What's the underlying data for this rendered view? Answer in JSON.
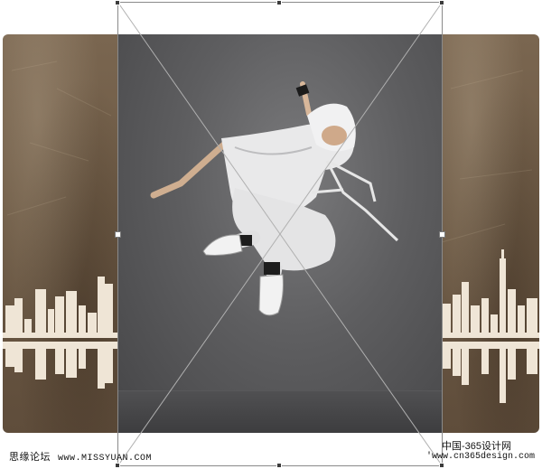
{
  "watermarks": {
    "left_cn": "思缘论坛",
    "left_site": "www.MISSYUAN.COM",
    "right_cn": "中国-365设计网",
    "right_site": "'www.cn365design.com"
  },
  "colors": {
    "texture": "#6d5a45",
    "skyline": "#efe5d6",
    "backdrop": "#5e5e60",
    "bounding_box": "#8a8a8a",
    "handle": "#3c3c3c"
  },
  "icons": [
    "transform-handle-icon"
  ]
}
